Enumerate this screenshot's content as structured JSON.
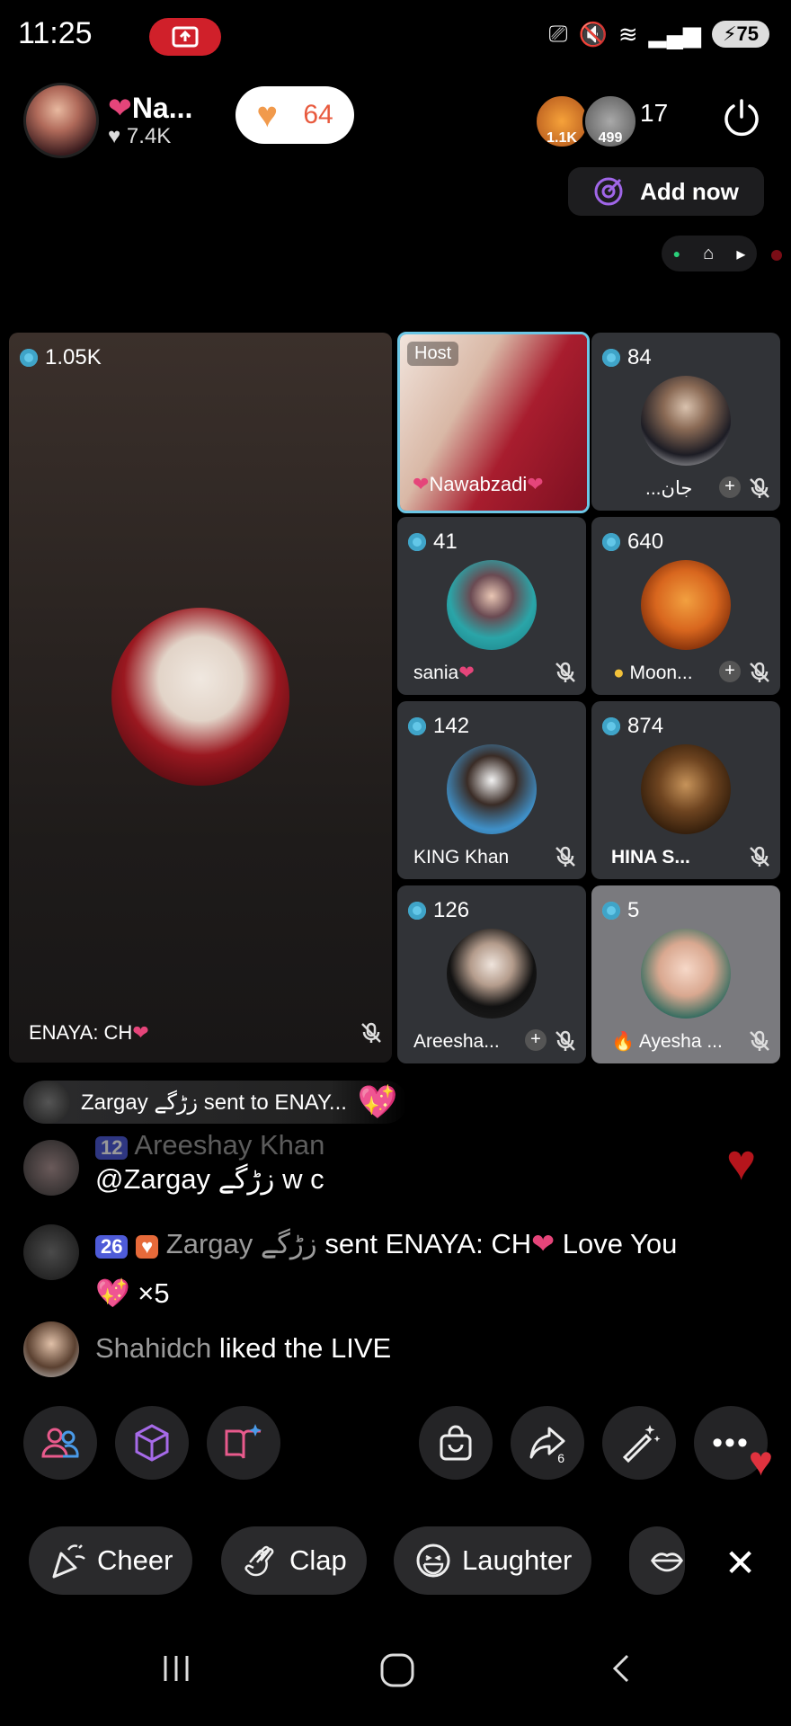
{
  "status_bar": {
    "time": "11:25",
    "battery": "75"
  },
  "header": {
    "host_name": "Na...",
    "host_likes": "7.4K",
    "heart_count": "64",
    "viewer_badges": [
      "1.1K",
      "499"
    ],
    "viewer_count": "17",
    "add_now_label": "Add now"
  },
  "seats": {
    "main": {
      "count": "1.05K",
      "name": "ENAYA: CH"
    },
    "host": {
      "label": "Host",
      "name": "Nawabzadi"
    },
    "list": [
      {
        "count": "84",
        "name": "...جان"
      },
      {
        "count": "41",
        "name": "sania"
      },
      {
        "count": "640",
        "name": "Moon..."
      },
      {
        "count": "142",
        "name": "KING Khan"
      },
      {
        "count": "874",
        "name": "HINA S..."
      },
      {
        "count": "126",
        "name": "Areesha..."
      },
      {
        "count": "5",
        "name": "Ayesha ..."
      }
    ]
  },
  "chat": {
    "gift_banner": "Zargay زڑگے sent to ENAY...",
    "messages": [
      {
        "badge": "12",
        "user": "Areeshay Khan",
        "text": "@Zargay زڑگے w c"
      },
      {
        "badge": "26",
        "user": "Zargay زڑگے",
        "text_1": "sent ENAYA: CH",
        "text_2": "Love You",
        "text_3": "×5"
      },
      {
        "user": "Shahidch",
        "text": "liked the LIVE"
      }
    ]
  },
  "toolbar": {
    "share_count": "6"
  },
  "reactions": [
    "Cheer",
    "Clap",
    "Laughter"
  ],
  "colors": {
    "accent_blue": "#63c7e8",
    "heart_pink": "#e5457a",
    "gift_orange": "#f19a4c",
    "record_red": "#d0202a"
  }
}
